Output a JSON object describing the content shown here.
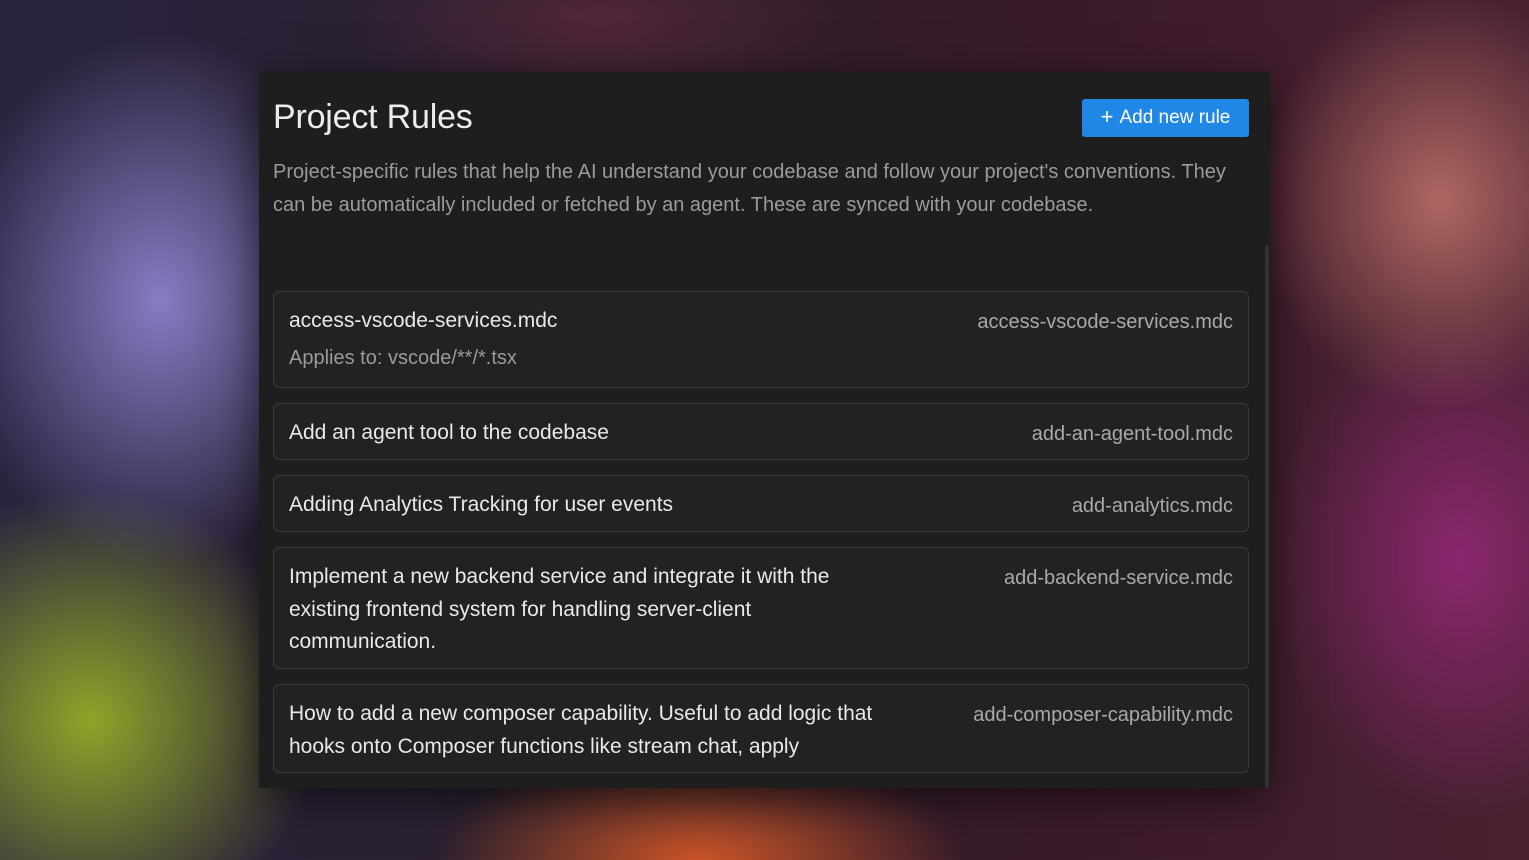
{
  "panel": {
    "title": "Project Rules",
    "add_button_label": "Add new rule",
    "description": "Project-specific rules that help the AI understand your codebase and follow your project's conventions. They can be automatically included or fetched by an agent. These are synced with your codebase."
  },
  "rules": [
    {
      "title": "access-vscode-services.mdc",
      "applies_to": "Applies to: vscode/**/*.tsx",
      "file": "access-vscode-services.mdc"
    },
    {
      "title": "Add an agent tool to the codebase",
      "file": "add-an-agent-tool.mdc"
    },
    {
      "title": "Adding Analytics Tracking for user events",
      "file": "add-analytics.mdc"
    },
    {
      "title": "Implement a new backend service and integrate it with the existing frontend system for handling server-client communication.",
      "file": "add-backend-service.mdc"
    },
    {
      "title": "How to add a new composer capability. Useful to add logic that hooks onto Composer functions like stream chat, apply",
      "file": "add-composer-capability.mdc"
    }
  ],
  "colors": {
    "accent": "#1f87e6",
    "panel_background": "#1e1e1f",
    "card_border": "#3a3a3c"
  },
  "icons": {
    "add_button": "plus-icon"
  }
}
